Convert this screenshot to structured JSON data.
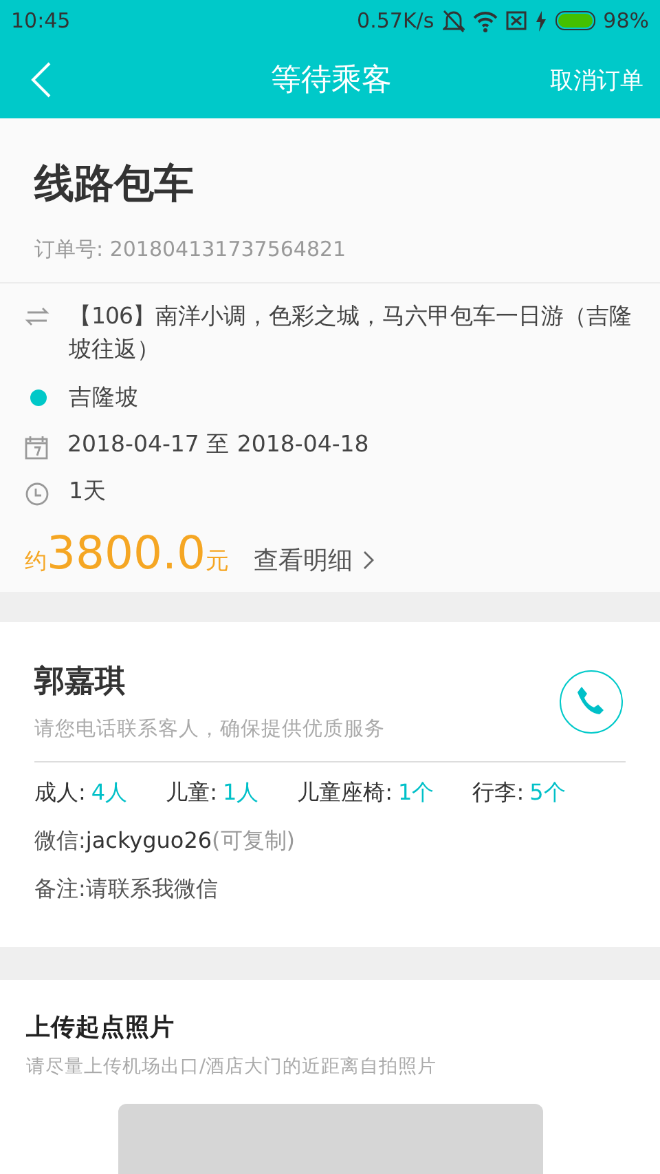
{
  "status_bar": {
    "time": "10:45",
    "speed": "0.57K/s",
    "battery": "98%"
  },
  "header": {
    "title": "等待乘客",
    "action": "取消订单"
  },
  "order": {
    "type": "线路包车",
    "order_no": "订单号: 201804131737564821",
    "route": "【106】南洋小调，色彩之城，马六甲包车一日游（吉隆坡往返）",
    "city": {
      "name": "吉隆坡",
      "color": "#00c8c8"
    },
    "dates": "2018-04-17 至 2018-04-18",
    "duration": "1天",
    "price": {
      "prefix": "约",
      "amount": "3800.0",
      "unit": "元"
    },
    "details_link": "查看明细"
  },
  "passenger": {
    "name": "郭嘉琪",
    "hint": "请您电话联系客人，确保提供优质服务",
    "counts": [
      {
        "label": "成人:",
        "value": "4人"
      },
      {
        "label": "儿童:",
        "value": "1人"
      },
      {
        "label": "儿童座椅:",
        "value": "1个"
      },
      {
        "label": "行李:",
        "value": "5个"
      }
    ],
    "wechat": {
      "label": "微信:",
      "id": "jackyguo26",
      "note": "(可复制)"
    },
    "remark": {
      "label": "备注:",
      "text": "请联系我微信"
    }
  },
  "upload": {
    "title": "上传起点照片",
    "hint": "请尽量上传机场出口/酒店大门的近距离自拍照片"
  }
}
